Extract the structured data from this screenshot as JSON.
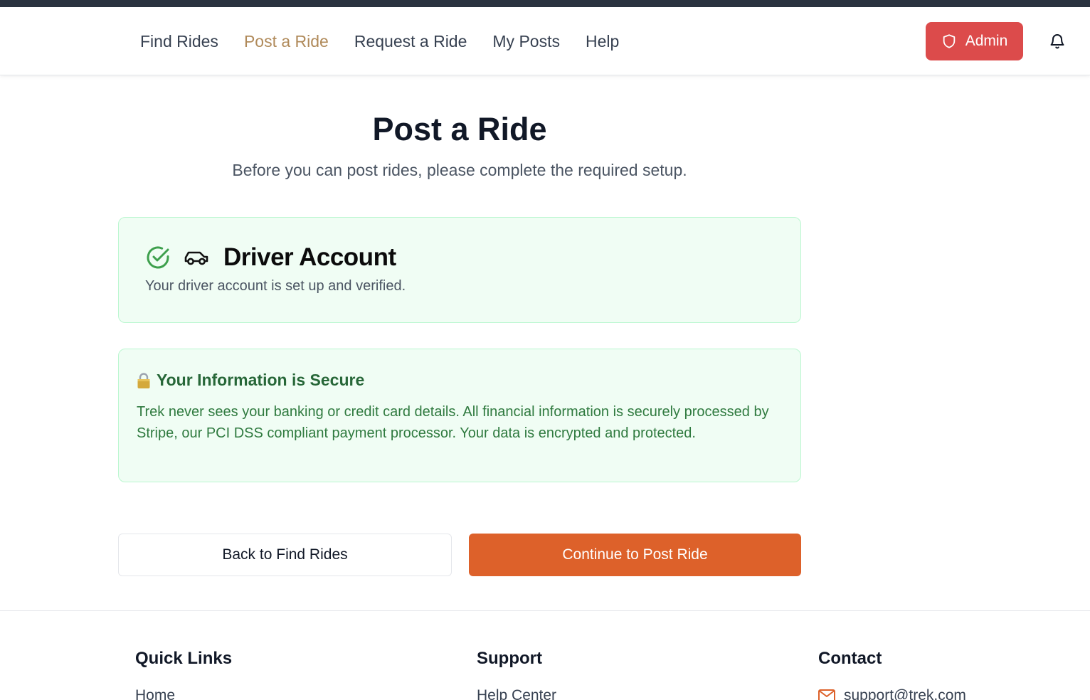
{
  "nav": {
    "links": [
      {
        "label": "Find Rides"
      },
      {
        "label": "Post a Ride"
      },
      {
        "label": "Request a Ride"
      },
      {
        "label": "My Posts"
      },
      {
        "label": "Help"
      }
    ],
    "active_index": 1,
    "admin_label": "Admin"
  },
  "main": {
    "title": "Post a Ride",
    "subtitle": "Before you can post rides, please complete the required setup."
  },
  "driver_card": {
    "title": "Driver Account",
    "text": "Your driver account is set up and verified.",
    "status_icon": "check-circle-icon",
    "icon": "car-icon"
  },
  "secure_card": {
    "title": "Your Information is Secure",
    "text": "Trek never sees your banking or credit card details. All financial information is securely processed by Stripe, our PCI DSS compliant payment processor. Your data is encrypted and protected.",
    "icon": "lock-icon"
  },
  "actions": {
    "back_label": "Back to Find Rides",
    "continue_label": "Continue to Post Ride"
  },
  "footer": {
    "quick_links": {
      "heading": "Quick Links",
      "first_item": "Home"
    },
    "support": {
      "heading": "Support",
      "first_item": "Help Center"
    },
    "contact": {
      "heading": "Contact",
      "email": "support@trek.com"
    }
  },
  "colors": {
    "accent": "#dd612a",
    "admin": "#dc4b4b",
    "active_nav": "#b08a5a",
    "success_bg": "#f0fdf4",
    "success_text": "#2f7a3f"
  }
}
